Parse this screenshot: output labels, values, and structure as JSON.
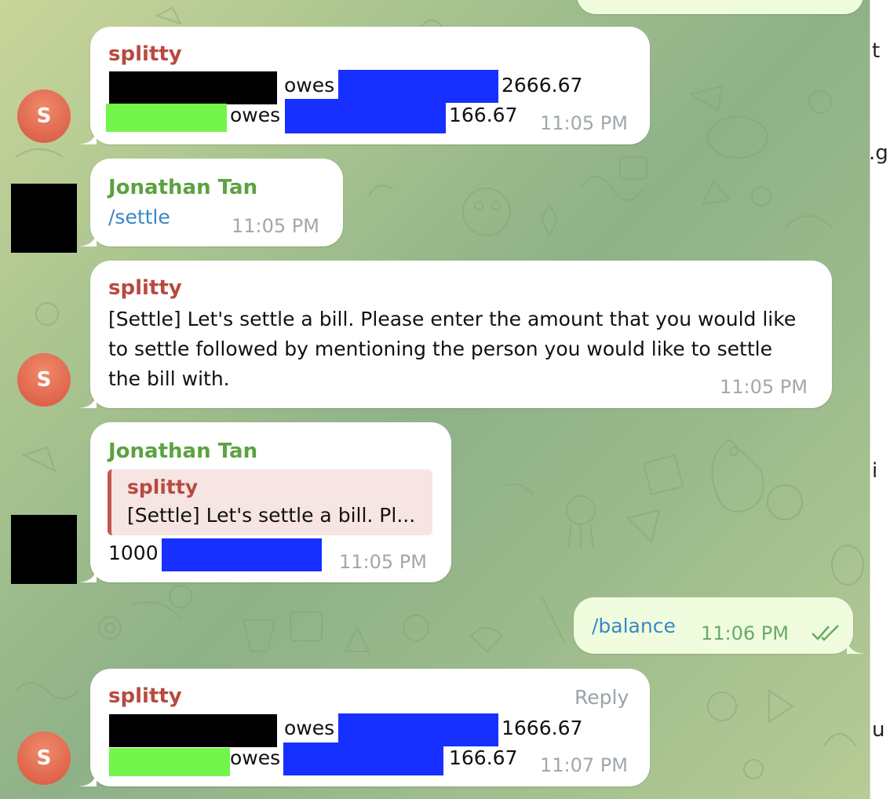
{
  "colors": {
    "bot_name": "#b84a3f",
    "user_name": "#5aa33f",
    "command": "#3a87c6",
    "outgoing_bubble": "#effdde",
    "redact_black": "#000000",
    "redact_blue": "#1730ff",
    "redact_green": "#73f54b"
  },
  "avatars": {
    "bot_initial": "S"
  },
  "messages": {
    "m1": {
      "sender": "splitty",
      "line1_verb": "owes",
      "line1_amount": "2666.67",
      "line2_verb": "owes",
      "line2_amount": "166.67",
      "time": "11:05 PM"
    },
    "m2": {
      "sender": "Jonathan Tan",
      "text": "/settle",
      "time": "11:05 PM"
    },
    "m3": {
      "sender": "splitty",
      "line1": "[Settle] Let's settle a bill. Please enter the amount that you would like",
      "line2": "to settle followed by mentioning the person you would like to settle",
      "line3": "the bill with.",
      "time": "11:05 PM"
    },
    "m4": {
      "sender": "Jonathan Tan",
      "quote_sender": "splitty",
      "quote_text": "[Settle] Let's settle a bill. Pl...",
      "text": "1000",
      "time": "11:05 PM"
    },
    "m5": {
      "text": "/balance",
      "time": "11:06 PM",
      "status_icon": "double-check-icon"
    },
    "m6": {
      "sender": "splitty",
      "reply": "Reply",
      "line1_verb": "owes",
      "line1_amount": "1666.67",
      "line2_verb": "owes",
      "line2_amount": "166.67",
      "time": "11:07 PM"
    }
  },
  "right_panel_fragments": [
    "t",
    ".g",
    "i",
    "u"
  ]
}
